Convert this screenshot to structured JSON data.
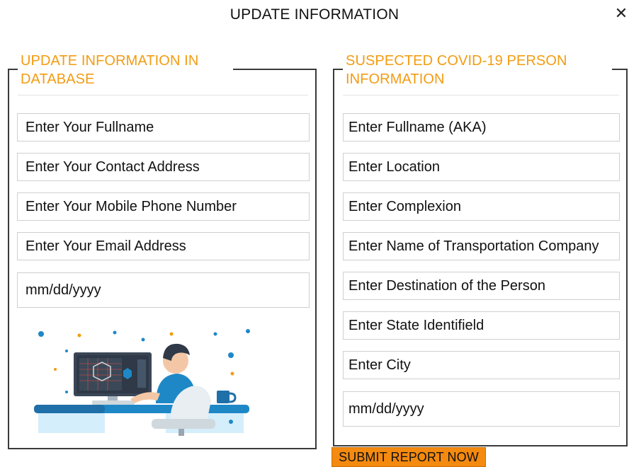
{
  "modal": {
    "title": "UPDATE INFORMATION",
    "close_glyph": "✕"
  },
  "left_panel": {
    "legend": "UPDATE INFORMATION IN DATABASE",
    "fields": [
      {
        "placeholder": "Enter Your Fullname"
      },
      {
        "placeholder": "Enter Your Contact Address"
      },
      {
        "placeholder": "Enter Your Mobile Phone Number"
      },
      {
        "placeholder": "Enter Your Email Address"
      },
      {
        "placeholder": "mm/dd/yyyy"
      }
    ],
    "illustration": "person-at-computer-illustration"
  },
  "right_panel": {
    "legend": "SUSPECTED COVID-19 PERSON INFORMATION",
    "fields": [
      {
        "placeholder": "Enter Fullname (AKA)"
      },
      {
        "placeholder": "Enter Location"
      },
      {
        "placeholder": "Enter Complexion"
      },
      {
        "placeholder": "Enter Name of Transportation Company"
      },
      {
        "placeholder": "Enter Destination of the Person"
      },
      {
        "placeholder": "Enter State Identifield"
      },
      {
        "placeholder": "Enter City"
      },
      {
        "placeholder": "mm/dd/yyyy"
      }
    ]
  },
  "submit": {
    "label": "SUBMIT REPORT NOW"
  },
  "colors": {
    "accent": "#f39c12",
    "button": "#f48a0f",
    "border": "#3a3a3a"
  }
}
